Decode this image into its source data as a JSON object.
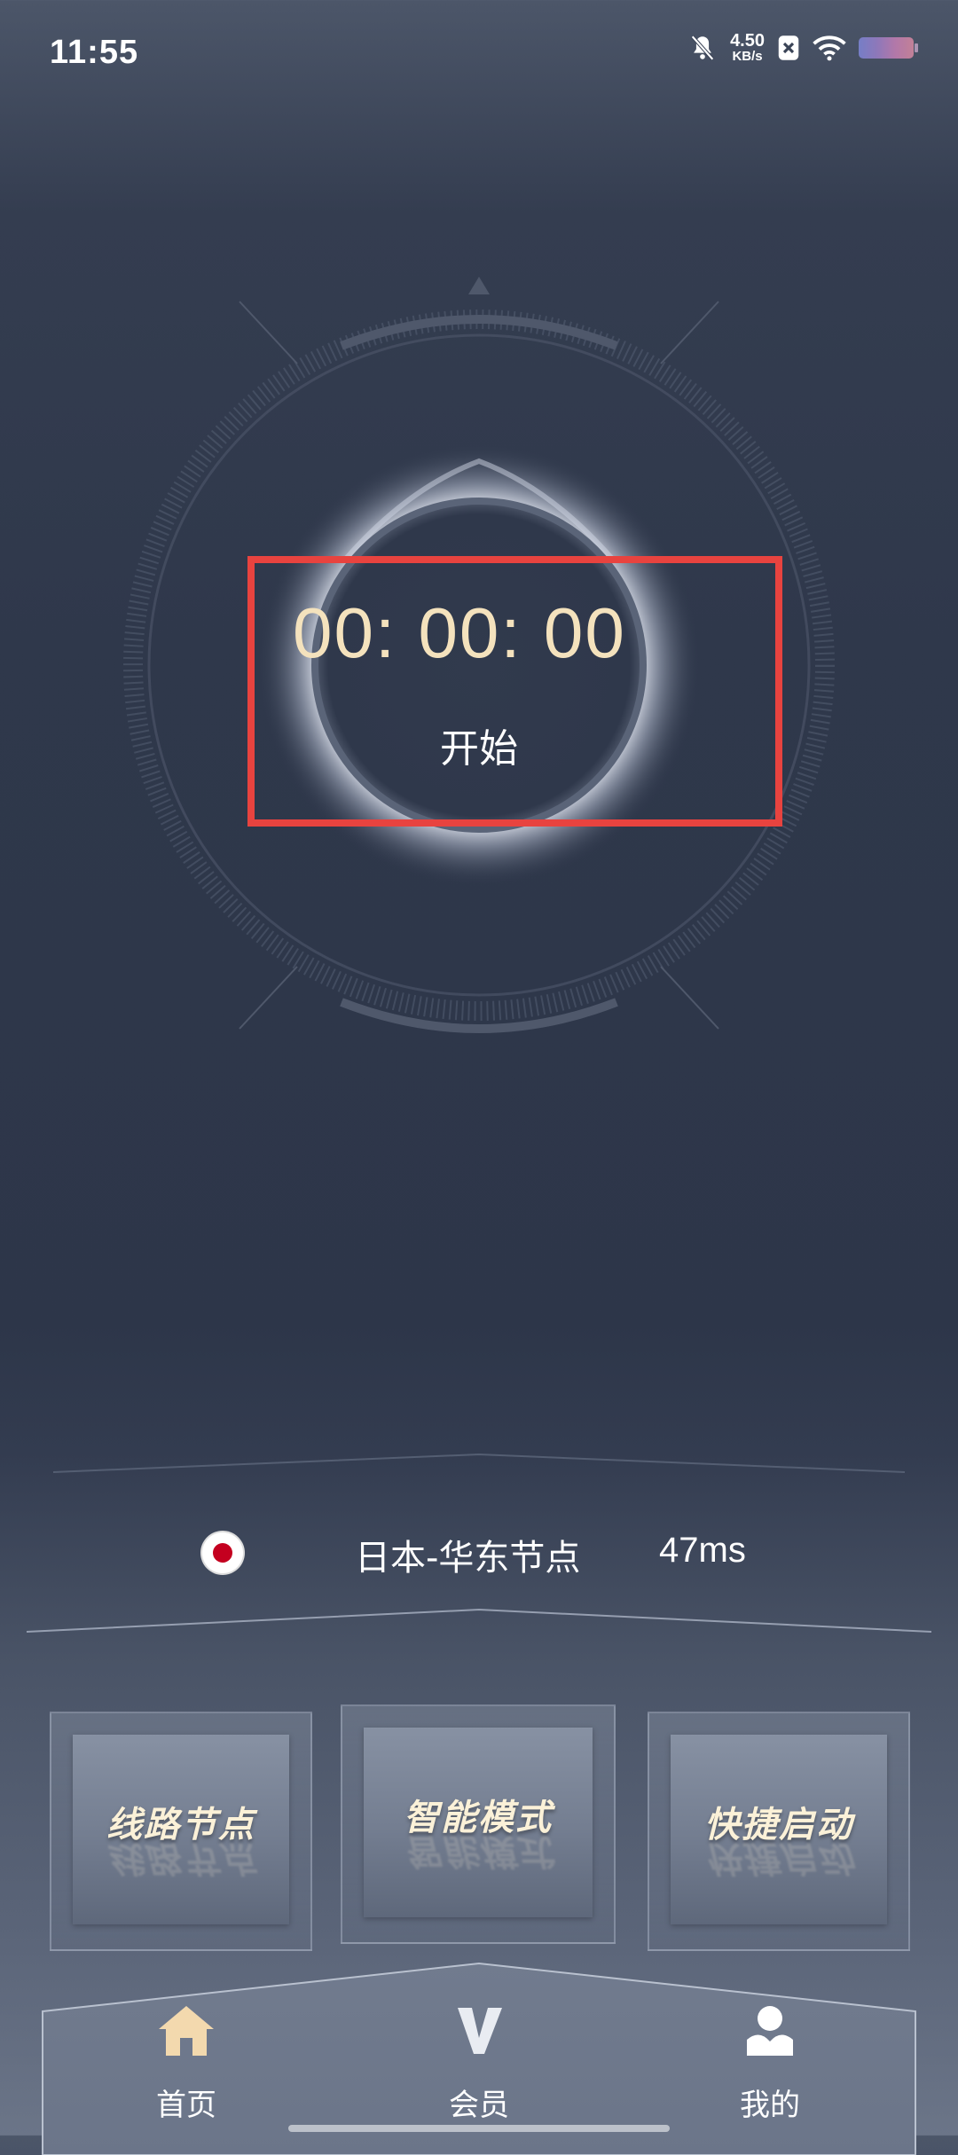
{
  "status_bar": {
    "time": "11:55",
    "net_speed_value": "4.50",
    "net_speed_unit": "KB/s",
    "icons": [
      "bell-muted-icon",
      "close-box-icon",
      "wifi-icon",
      "battery-icon"
    ]
  },
  "timer": {
    "display": "00:  00:  00",
    "start_label": "开始"
  },
  "node": {
    "flag": "japan-flag-icon",
    "name": "日本-华东节点",
    "latency": "47ms"
  },
  "cards": [
    {
      "label": "线路节点"
    },
    {
      "label": "智能模式"
    },
    {
      "label": "快捷启动"
    }
  ],
  "bottom_nav": [
    {
      "label": "首页",
      "icon": "home-icon"
    },
    {
      "label": "会员",
      "icon": "vip-v-icon"
    },
    {
      "label": "我的",
      "icon": "user-icon"
    }
  ],
  "colors": {
    "accent_timer": "#f4e2bd",
    "highlight_box": "#e8433f",
    "card_text": "#fbf1d8",
    "nav_icon": "#f3d9ae"
  }
}
